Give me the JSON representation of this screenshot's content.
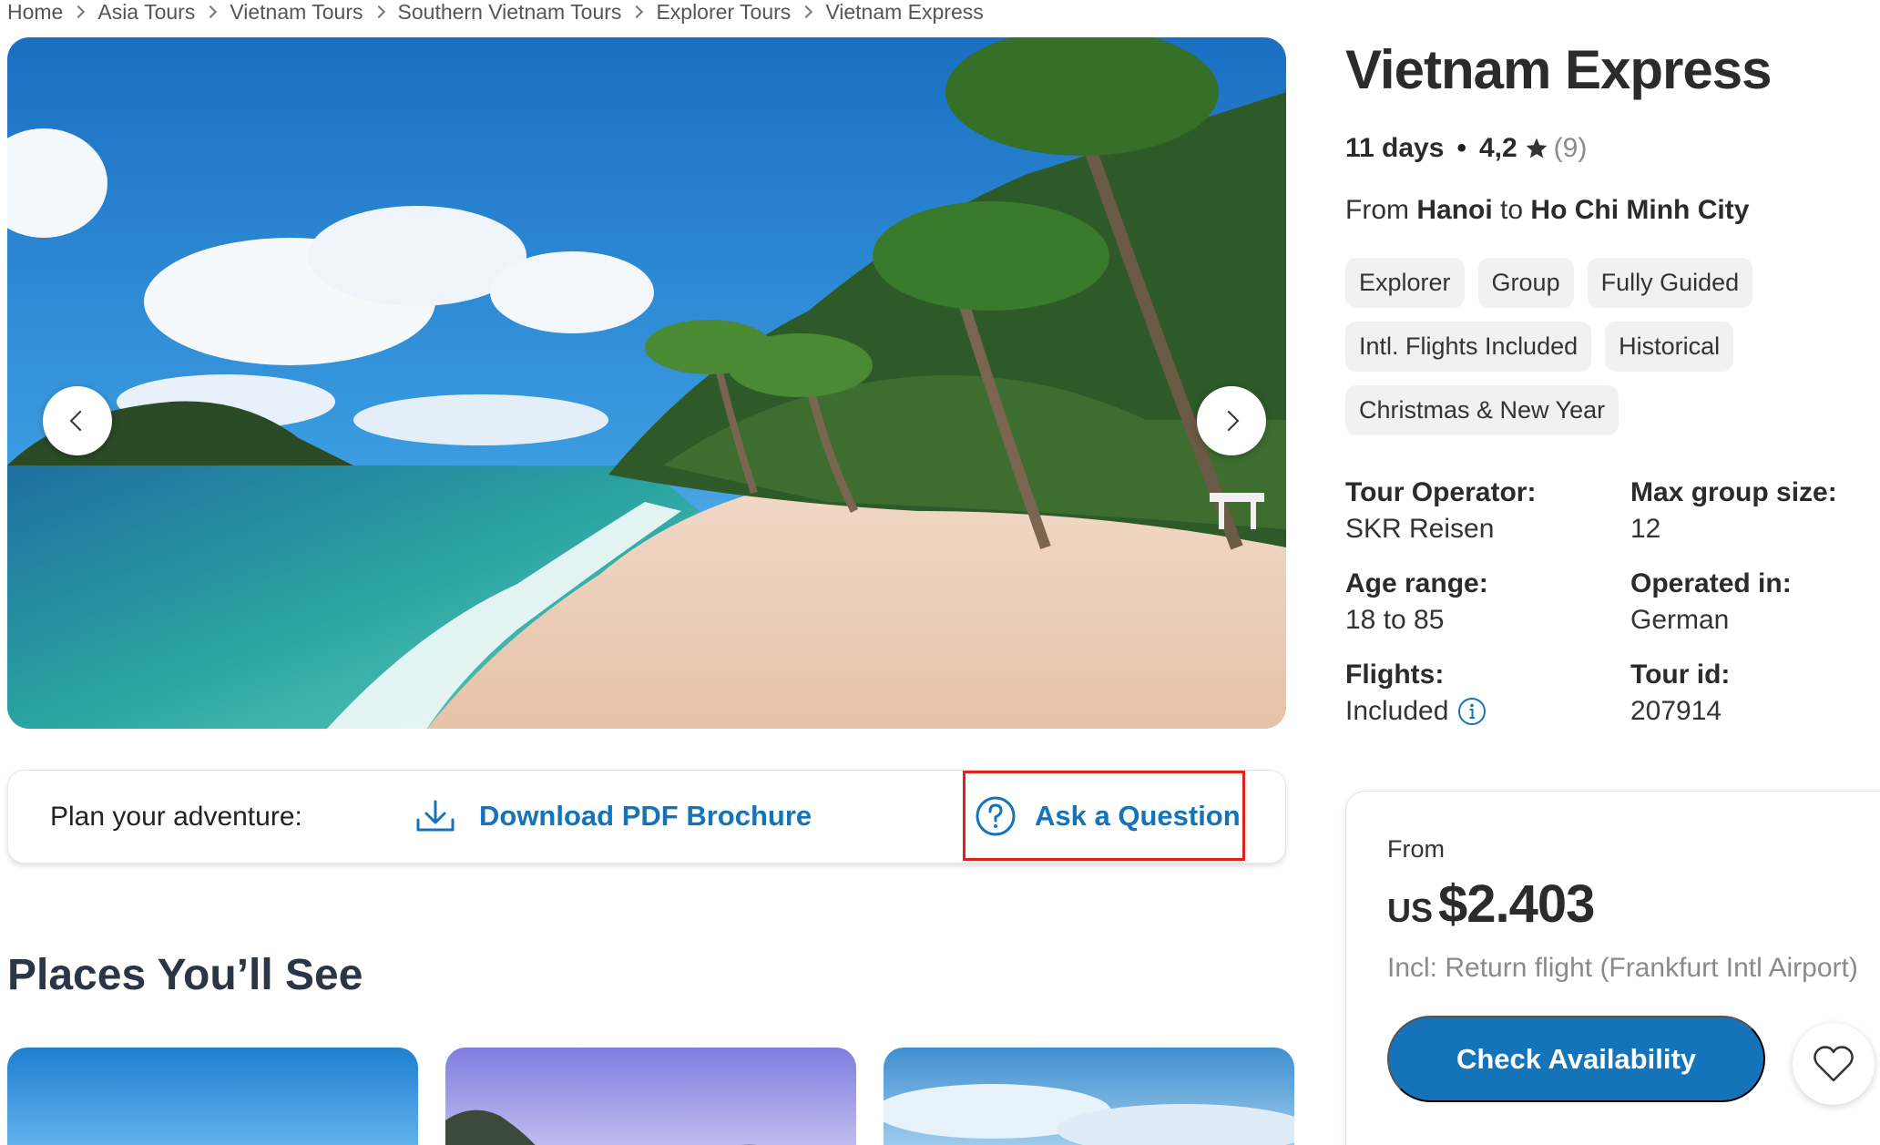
{
  "breadcrumb": [
    "Home",
    "Asia Tours",
    "Vietnam Tours",
    "Southern Vietnam Tours",
    "Explorer Tours",
    "Vietnam Express"
  ],
  "tour": {
    "title": "Vietnam Express",
    "days": "11 days",
    "rating": "4,2",
    "reviews": "(9)",
    "route_from_prefix": "From",
    "route_from": "Hanoi",
    "route_to_prefix": "to",
    "route_to": "Ho Chi Minh City",
    "tags": [
      "Explorer",
      "Group",
      "Fully Guided",
      "Intl. Flights Included",
      "Historical",
      "Christmas & New Year"
    ]
  },
  "facts": {
    "operator_label": "Tour Operator:",
    "operator_value": "SKR Reisen",
    "group_label": "Max group size:",
    "group_value": "12",
    "age_label": "Age range:",
    "age_value": "18 to 85",
    "operated_label": "Operated in:",
    "operated_value": "German",
    "flights_label": "Flights:",
    "flights_value": "Included",
    "tourid_label": "Tour id:",
    "tourid_value": "207914"
  },
  "plan": {
    "label": "Plan your adventure:",
    "download": "Download PDF Brochure",
    "ask": "Ask a Question"
  },
  "places": {
    "title": "Places You’ll See"
  },
  "price": {
    "from": "From",
    "currency": "US",
    "amount": "$2.403",
    "incl": "Incl: Return flight (Frankfurt Intl Airport)",
    "cta": "Check Availability"
  },
  "colors": {
    "primary_blue": "#1473b9",
    "highlight_red": "#e0221b",
    "heading_dark": "#2a3645"
  },
  "icons": {
    "download": "download-icon",
    "question": "question-circle-icon",
    "star": "star-icon",
    "info": "info-icon",
    "heart": "heart-icon",
    "prev": "chevron-left-icon",
    "next": "chevron-right-icon"
  }
}
